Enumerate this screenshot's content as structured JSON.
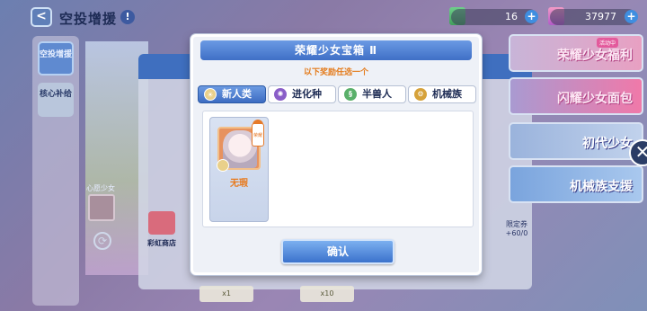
{
  "header": {
    "back_icon": "back-arrow-icon",
    "title": "空投增援",
    "info_icon": "info-icon",
    "resource1_value": "16",
    "resource2_value": "37977"
  },
  "sidebar": {
    "tabs": [
      {
        "label": "空投增援"
      },
      {
        "label": "核心补给"
      }
    ]
  },
  "background": {
    "char_label": "心愿少女",
    "shop_label": "彩虹商店",
    "price_right": "限定券 +60/0",
    "price_left": "+",
    "bottom_card1": "x1",
    "bottom_card2": "x10"
  },
  "banners": [
    {
      "label": "荣耀少女福利"
    },
    {
      "label": "闪耀少女面包"
    },
    {
      "label": "初代少女"
    },
    {
      "label": "机械族支援"
    }
  ],
  "banner_event_tag": "活动中",
  "modal": {
    "title": "荣耀少女宝箱 Ⅱ",
    "subtitle": "以下奖励任选一个",
    "tabs": [
      {
        "label": "新人类",
        "icon": "human-icon",
        "active": true
      },
      {
        "label": "进化种",
        "icon": "evolved-icon",
        "active": false
      },
      {
        "label": "半兽人",
        "icon": "beastkin-icon",
        "active": false
      },
      {
        "label": "机械族",
        "icon": "mech-icon",
        "active": false
      }
    ],
    "items": [
      {
        "name": "无瑕",
        "badge": "荣耀"
      }
    ],
    "confirm_label": "确认"
  },
  "colors": {
    "accent_blue": "#3f6fc6",
    "subtitle_orange": "#e47b1b",
    "item_name_orange": "#e87a1e"
  }
}
